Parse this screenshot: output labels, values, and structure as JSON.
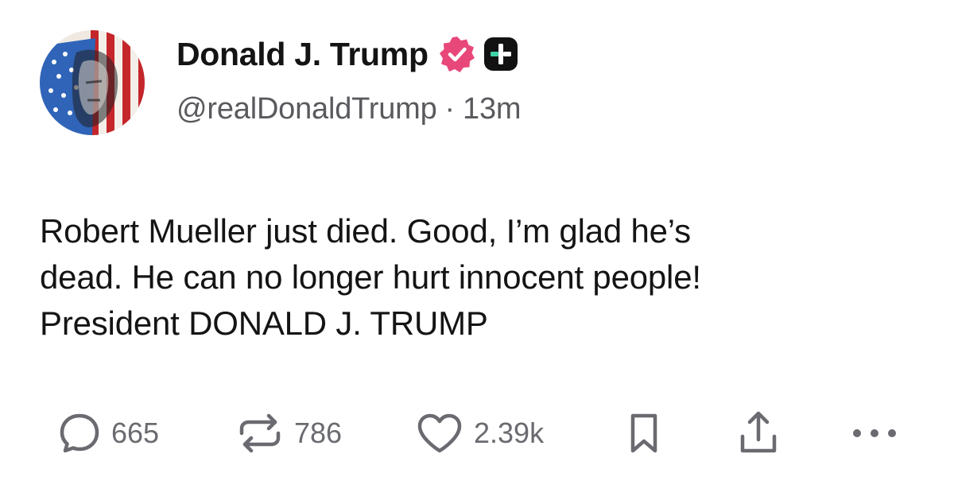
{
  "author": {
    "display_name": "Donald J. Trump",
    "handle": "@realDonaldTrump",
    "separator": "·",
    "time_ago": "13m",
    "avatar_icon": "avatar-portrait-flag",
    "verified_icon": "verified-badge-icon",
    "plus_icon": "plus-badge-icon"
  },
  "post": {
    "lines": [
      "Robert Mueller just died. Good, I’m glad he’s",
      "dead. He can no longer hurt innocent people!",
      "President DONALD J. TRUMP"
    ]
  },
  "actions": {
    "replies": "665",
    "reposts": "786",
    "likes": "2.39k"
  },
  "colors": {
    "verified": "#e8477a",
    "plus_badge": "#121212",
    "plus_accent": "#3fd3a8",
    "icon_gray": "#6a6a70",
    "text": "#141414"
  }
}
